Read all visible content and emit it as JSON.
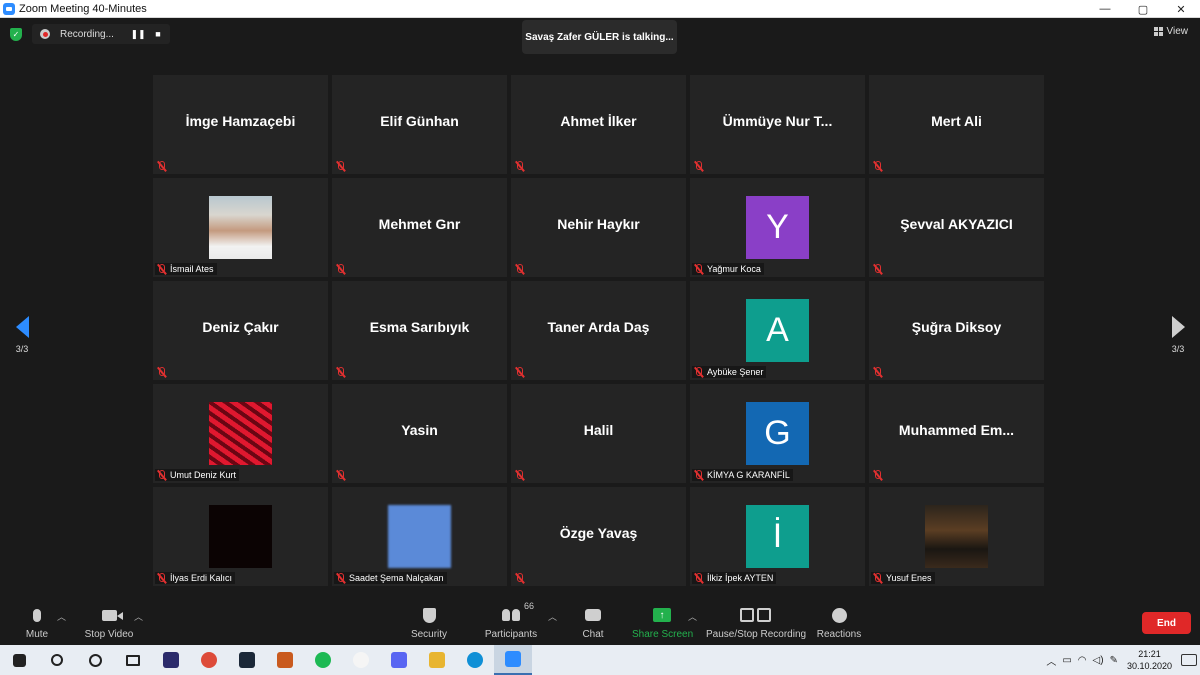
{
  "window": {
    "title": "Zoom Meeting 40-Minutes",
    "controls": [
      "—",
      "▢",
      "✕"
    ]
  },
  "recording": {
    "label": "Recording...",
    "pause": "❚❚",
    "stop": "■"
  },
  "talking": "Savaş Zafer GÜLER is talking...",
  "view_label": "View",
  "pager": {
    "left": "3/3",
    "right": "3/3"
  },
  "participants": [
    {
      "name": "İmge Hamzaçebi",
      "display": "name"
    },
    {
      "name": "Elif Günhan",
      "display": "name"
    },
    {
      "name": "Ahmet İlker",
      "display": "name"
    },
    {
      "name": "Ümmüye Nur T...",
      "display": "name"
    },
    {
      "name": "Mert Ali",
      "display": "name"
    },
    {
      "name": "İsmail Ates",
      "display": "image",
      "image": "ismail"
    },
    {
      "name": "Mehmet Gnr",
      "display": "name"
    },
    {
      "name": "Nehir Haykır",
      "display": "name"
    },
    {
      "name": "Yağmur Koca",
      "display": "initial",
      "initial": "Y",
      "color": "#8a3fc7"
    },
    {
      "name": "Şevval AKYAZICI",
      "display": "name"
    },
    {
      "name": "Deniz Çakır",
      "display": "name"
    },
    {
      "name": "Esma Sarıbıyık",
      "display": "name"
    },
    {
      "name": "Taner Arda Daş",
      "display": "name"
    },
    {
      "name": "Aybüke Şener",
      "display": "initial",
      "initial": "A",
      "color": "#0e9e8e"
    },
    {
      "name": "Şuğra Diksoy",
      "display": "name"
    },
    {
      "name": "Umut Deniz Kurt",
      "display": "image",
      "image": "wave"
    },
    {
      "name": "Yasin",
      "display": "name"
    },
    {
      "name": "Halil",
      "display": "name"
    },
    {
      "name": "KİMYA G KARANFİL",
      "display": "initial",
      "initial": "G",
      "color": "#1368b3"
    },
    {
      "name": "Muhammed  Em...",
      "display": "name"
    },
    {
      "name": "İlyas Erdi Kalıcı",
      "display": "image",
      "image": "dark"
    },
    {
      "name": "Saadet Şema Nalçakan",
      "display": "image",
      "image": "blue"
    },
    {
      "name": "Özge Yavaş",
      "display": "name"
    },
    {
      "name": "İlkiz İpek AYTEN",
      "display": "initial",
      "initial": "İ",
      "color": "#0e9e8e"
    },
    {
      "name": "Yusuf Enes",
      "display": "image",
      "image": "street"
    }
  ],
  "toolbar": {
    "mute": "Mute",
    "stop_video": "Stop Video",
    "security": "Security",
    "participants": "Participants",
    "participants_count": "66",
    "chat": "Chat",
    "share_screen": "Share Screen",
    "pause_stop_recording": "Pause/Stop Recording",
    "reactions": "Reactions",
    "end": "End"
  },
  "taskbar": {
    "time": "21:21",
    "date": "30.10.2020",
    "app_colors": [
      "#2b2b6b",
      "#dd4b39",
      "#1b2838",
      "#c95a1e",
      "#1db954",
      "#f5f5f5",
      "#5865f2",
      "#e8b530",
      "#0f8fd6",
      "#2d8cff"
    ]
  }
}
